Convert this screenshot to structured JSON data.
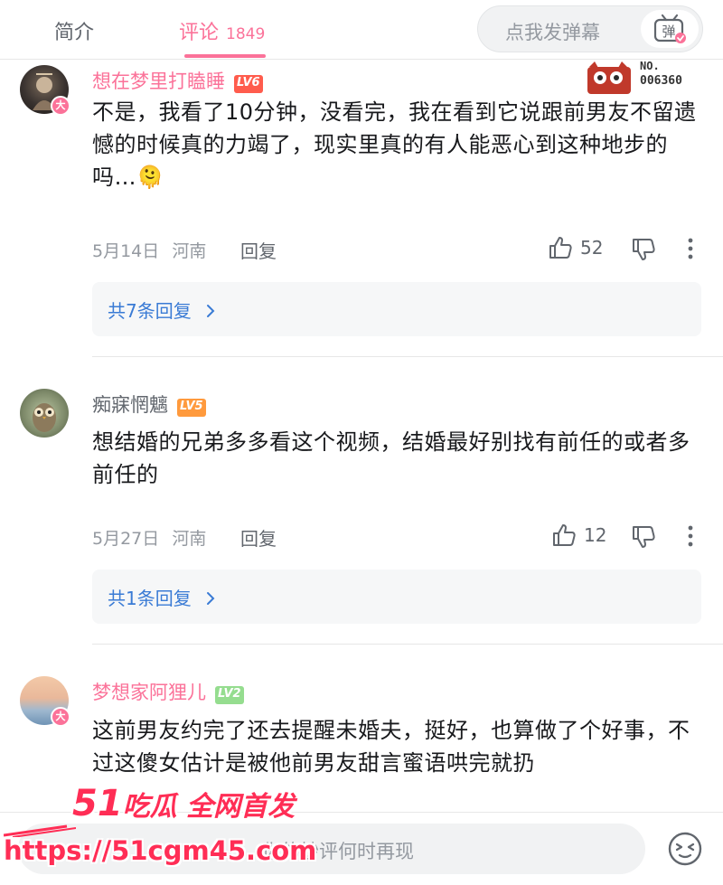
{
  "tabs": [
    {
      "label": "简介"
    },
    {
      "label": "评论",
      "count": "1849"
    }
  ],
  "danmaku": {
    "placeholder": "点我发弹幕",
    "button_glyph": "弹"
  },
  "comments": [
    {
      "username": "想在梦里打瞌睡",
      "level": "LV6",
      "avatar_badge": "大",
      "fan_badge": {
        "label": "NO.",
        "number": "006360"
      },
      "text": "不是，我看了10分钟，没看完，我在看到它说跟前男友不留遗憾的时候真的力竭了，现实里真的有人能恶心到这种地步的吗…🫠",
      "date": "5月14日",
      "location": "河南",
      "reply_label": "回复",
      "likes": "52",
      "replies_summary": "共7条回复"
    },
    {
      "username": "痴寐惘魑",
      "level": "LV5",
      "avatar_badge": "",
      "text": "想结婚的兄弟多多看这个视频，结婚最好别找有前任的或者多前任的",
      "date": "5月27日",
      "location": "河南",
      "reply_label": "回复",
      "likes": "12",
      "replies_summary": "共1条回复"
    },
    {
      "username": "梦想家阿狸儿",
      "level": "LV2",
      "avatar_badge": "大",
      "text": "这前男友约完了还去提醒未婚夫，挺好，也算做了个好事，不过这傻女估计是被他前男友甜言蜜语哄完就扔"
    }
  ],
  "input": {
    "placeholder": "你的妙评何时再现"
  },
  "watermark": {
    "line1_num": "51",
    "line1_text": "吃瓜 全网首发",
    "line2": "https://51cgm45.com"
  },
  "colors": {
    "accent": "#fb7299",
    "link": "#3a7bd5",
    "lv6": "#ff5c4d",
    "lv5": "#ff9a3d",
    "lv2": "#95dd8f"
  }
}
